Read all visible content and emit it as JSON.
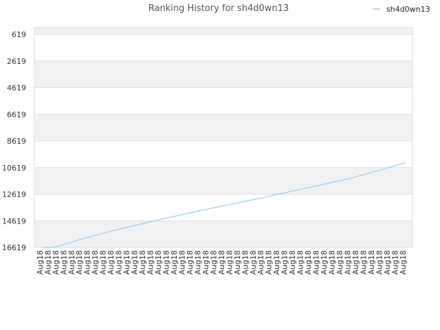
{
  "chart_data": {
    "type": "line",
    "title": "Ranking History for sh4d0wn13",
    "xlabel": "",
    "ylabel": "",
    "y_inverted": true,
    "ylim": [
      16619,
      619
    ],
    "yticks": [
      619,
      2619,
      4619,
      6619,
      8619,
      10619,
      12619,
      14619,
      16619
    ],
    "grid": true,
    "legend_position": "top-right",
    "categories": [
      "Aug18",
      "Aug18",
      "Aug18",
      "Aug18",
      "Aug18",
      "Aug18",
      "Aug18",
      "Aug18",
      "Aug18",
      "Aug18",
      "Aug18",
      "Aug18",
      "Aug18",
      "Aug18",
      "Aug18",
      "Aug18",
      "Aug18",
      "Aug18",
      "Aug18",
      "Aug18",
      "Aug18",
      "Aug18",
      "Aug18",
      "Aug18",
      "Aug18",
      "Aug18",
      "Aug18",
      "Aug18",
      "Aug18",
      "Aug18",
      "Aug18",
      "Aug18",
      "Aug18",
      "Aug18",
      "Aug18",
      "Aug18",
      "Aug18",
      "Aug18",
      "Aug18",
      "Aug18",
      "Aug18",
      "Aug18",
      "Aug18",
      "Aug18",
      "Aug18",
      "Aug18",
      "Aug18"
    ],
    "series": [
      {
        "name": "sh4d0wn13",
        "color": "#99ccee",
        "values": [
          16619,
          16619,
          16520,
          16330,
          16150,
          15980,
          15820,
          15660,
          15500,
          15350,
          15200,
          15060,
          14920,
          14780,
          14640,
          14500,
          14370,
          14240,
          14110,
          13980,
          13850,
          13720,
          13600,
          13480,
          13360,
          13230,
          13110,
          12990,
          12860,
          12730,
          12600,
          12470,
          12340,
          12210,
          12080,
          11950,
          11820,
          11690,
          11560,
          11420,
          11260,
          11100,
          10930,
          10760,
          10590,
          10420,
          10250
        ]
      }
    ]
  },
  "colors": {
    "band_shaded": "#f2f2f2",
    "band_plain": "#ffffff",
    "grid": "#e0e0e0",
    "border": "#dddddd"
  }
}
